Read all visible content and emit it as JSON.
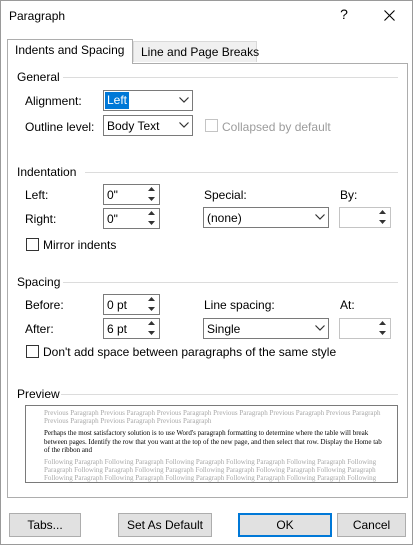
{
  "window": {
    "title": "Paragraph",
    "help": "?"
  },
  "tabs": [
    {
      "label": "Indents and Spacing",
      "active": true
    },
    {
      "label": "Line and Page Breaks",
      "active": false
    }
  ],
  "general": {
    "title": "General",
    "alignment_label": "Alignment:",
    "alignment_value": "Left",
    "outline_label": "Outline level:",
    "outline_value": "Body Text",
    "collapsed_label": "Collapsed by default"
  },
  "indentation": {
    "title": "Indentation",
    "left_label": "Left:",
    "left_value": "0\"",
    "right_label": "Right:",
    "right_value": "0\"",
    "special_label": "Special:",
    "special_value": "(none)",
    "by_label": "By:",
    "by_value": "",
    "mirror_label": "Mirror indents"
  },
  "spacing": {
    "title": "Spacing",
    "before_label": "Before:",
    "before_value": "0 pt",
    "after_label": "After:",
    "after_value": "6 pt",
    "line_spacing_label": "Line spacing:",
    "line_spacing_value": "Single",
    "at_label": "At:",
    "at_value": "",
    "dont_add_label": "Don't add space between paragraphs of the same style"
  },
  "preview": {
    "title": "Preview",
    "previous_text": "Previous Paragraph Previous Paragraph Previous Paragraph Previous Paragraph Previous Paragraph Previous Paragraph Previous Paragraph Previous Paragraph Previous Paragraph",
    "current_text": "Perhaps the most satisfactory solution is to use Word's paragraph formatting to determine where the table will break between pages. Identify the row that you want at the top of the new page, and then select that row. Display the Home tab of the ribbon and",
    "following_text": "Following Paragraph Following Paragraph Following Paragraph Following Paragraph Following Paragraph Following Paragraph Following Paragraph Following Paragraph Following Paragraph Following Paragraph Following Paragraph Following Paragraph Following Paragraph Following Paragraph Following Paragraph Following Paragraph Following Paragraph Following Paragraph Following Paragraph Following Paragraph Following Paragraph"
  },
  "buttons": {
    "tabs": "Tabs...",
    "set_default": "Set As Default",
    "ok": "OK",
    "cancel": "Cancel"
  },
  "colors": {
    "accent": "#0078d7",
    "border": "#7a7a7a",
    "button_bg": "#e1e1e1"
  }
}
